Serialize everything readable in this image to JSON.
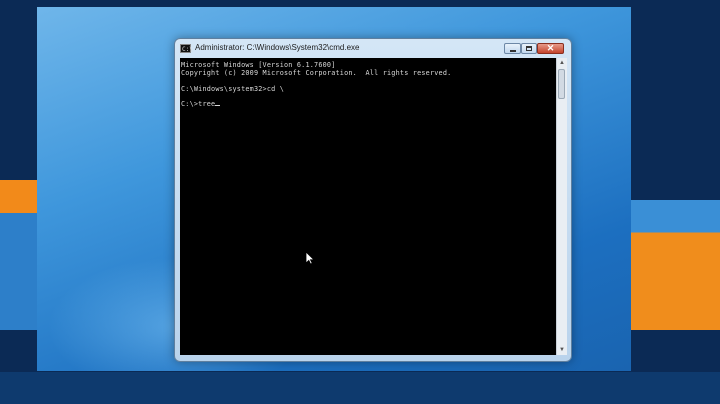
{
  "window": {
    "title": "Administrator: C:\\Windows\\System32\\cmd.exe",
    "icon": "cmd-icon",
    "icon_text": "C:\\"
  },
  "controls": {
    "minimize_icon": "minimize-icon",
    "maximize_icon": "maximize-icon",
    "close_icon": "close-icon",
    "close_glyph": "✕"
  },
  "console": {
    "lines": [
      "Microsoft Windows [Version 6.1.7600]",
      "Copyright (c) 2009 Microsoft Corporation.  All rights reserved.",
      "",
      "C:\\Windows\\system32>cd \\",
      "",
      "C:\\>tree"
    ],
    "background": "#000000",
    "text_color": "#d8d8d8"
  },
  "scrollbar": {
    "up_arrow": "▲",
    "down_arrow": "▼"
  },
  "colors": {
    "desktop_top": "#6fb6ea",
    "desktop_bottom": "#1a64b0",
    "close_button": "#c4442c"
  }
}
